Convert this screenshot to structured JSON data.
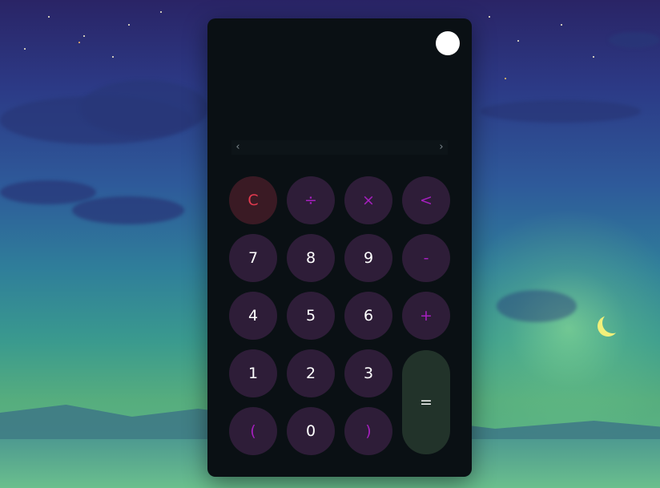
{
  "calculator": {
    "display_value": "",
    "history_prev_arrow": "‹",
    "history_next_arrow": "›",
    "keys": {
      "clear": "C",
      "divide": "÷",
      "multiply": "×",
      "backspace": "<",
      "seven": "7",
      "eight": "8",
      "nine": "9",
      "minus": "-",
      "four": "4",
      "five": "5",
      "six": "6",
      "plus": "+",
      "one": "1",
      "two": "2",
      "three": "3",
      "equals": "=",
      "open_paren": "(",
      "zero": "0",
      "close_paren": ")"
    }
  },
  "colors": {
    "panel_bg": "#0a1014",
    "button_bg": "#2e1d38",
    "operator_text": "#a61fbf",
    "clear_bg": "#3a1a24",
    "clear_text": "#e33a4f",
    "equals_bg": "#22332a",
    "theme_toggle": "#ffffff"
  },
  "icons": {
    "theme_toggle": "theme-toggle-icon",
    "history_prev": "chevron-left-icon",
    "history_next": "chevron-right-icon"
  }
}
